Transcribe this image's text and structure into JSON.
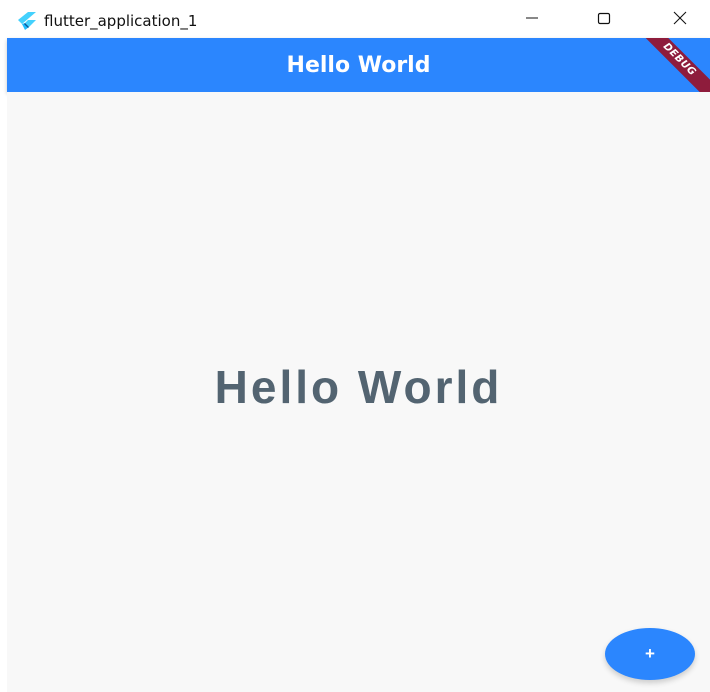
{
  "window": {
    "title": "flutter_application_1",
    "controls": {
      "minimize_icon": "minimize-icon",
      "maximize_icon": "maximize-icon",
      "close_icon": "close-icon"
    }
  },
  "appbar": {
    "title": "Hello World",
    "color": "#2b86fe",
    "debug_banner": "DEBUG"
  },
  "body": {
    "text": "Hello World",
    "text_color": "#536471"
  },
  "fab": {
    "label": "+",
    "icon": "add-icon"
  }
}
